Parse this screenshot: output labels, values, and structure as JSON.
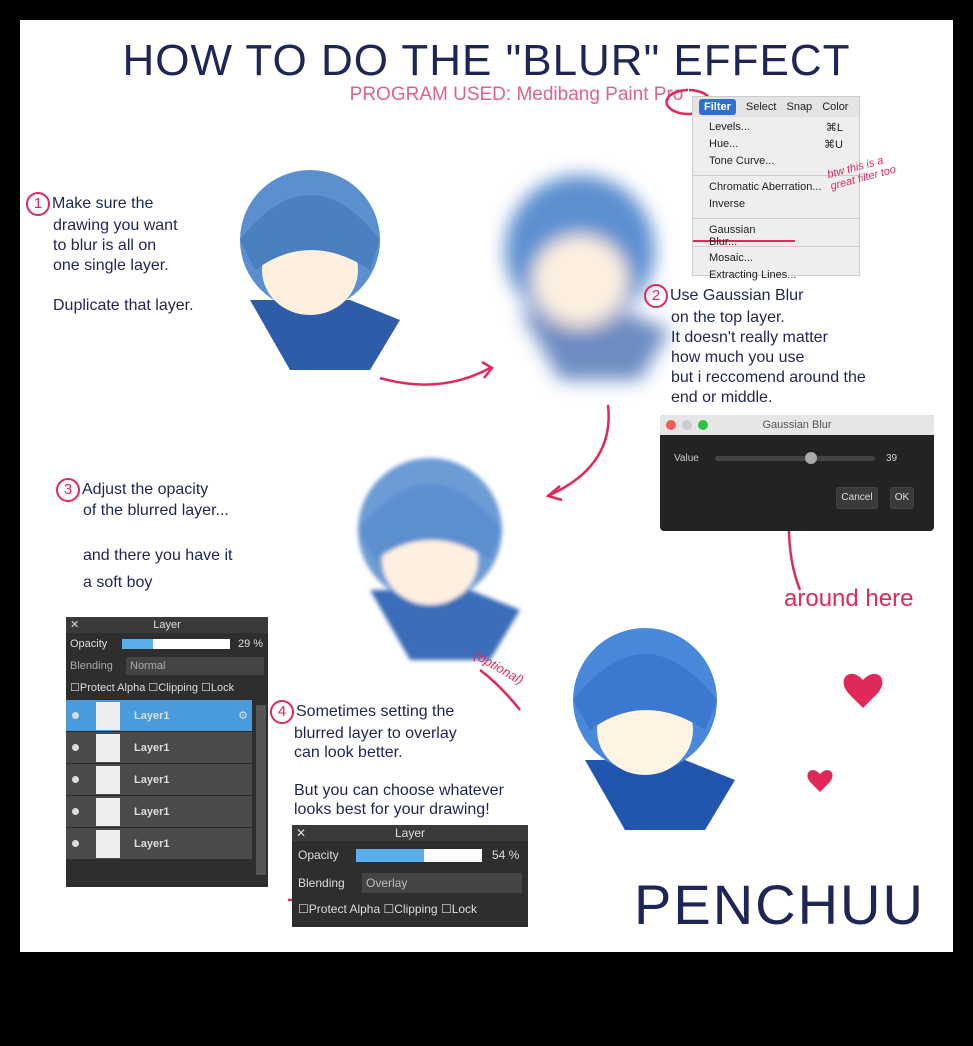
{
  "title": "HOW TO DO THE \"BLUR\" EFFECT",
  "subtitle": "PROGRAM USED: Medibang Paint Pro",
  "steps": [
    {
      "num": "1",
      "lines": [
        "Make sure the",
        "drawing you want",
        "to blur is all on",
        "one single layer."
      ],
      "extra": "Duplicate that layer."
    },
    {
      "num": "2",
      "lines": [
        "Use Gaussian Blur",
        "on the top layer.",
        "It doesn't really matter",
        "how much you use",
        "but i reccomend around the",
        "end or middle."
      ]
    },
    {
      "num": "3",
      "lines": [
        "Adjust the opacity",
        "of the blurred layer..."
      ],
      "extra": "and there you have it",
      "extra2": "a soft boy"
    },
    {
      "num": "4",
      "lines": [
        "Sometimes setting the",
        "blurred layer to overlay",
        "can look better."
      ],
      "extra": "But you can choose whatever",
      "extra2": "looks best for your drawing!"
    }
  ],
  "menu": {
    "bar": [
      "Filter",
      "Select",
      "Snap",
      "Color"
    ],
    "items": [
      [
        "Levels...",
        "⌘L"
      ],
      [
        "Hue...",
        "⌘U"
      ],
      [
        "Tone Curve...",
        ""
      ],
      [
        "Chromatic Aberration...",
        ""
      ],
      [
        "Inverse",
        ""
      ],
      [
        "Gaussian Blur...",
        ""
      ],
      [
        "Mosaic...",
        ""
      ],
      [
        "Extracting Lines...",
        ""
      ]
    ]
  },
  "note_btw": "btw this is a great filter too",
  "dialog": {
    "title": "Gaussian Blur",
    "label": "Value",
    "value": "39",
    "slider_fraction": 0.6,
    "cancel": "Cancel",
    "ok": "OK"
  },
  "around_here": "around here",
  "optional": "(optional)",
  "layer_panel1": {
    "title": "Layer",
    "opacity_label": "Opacity",
    "opacity": 29,
    "opacity_text": "29 %",
    "blending_label": "Blending",
    "blending": "Normal",
    "protect": "Protect Alpha",
    "clipping": "Clipping",
    "lock": "Lock",
    "layers": [
      "Layer1",
      "Layer1",
      "Layer1",
      "Layer1",
      "Layer1"
    ]
  },
  "layer_panel2": {
    "title": "Layer",
    "opacity_label": "Opacity",
    "opacity": 54,
    "opacity_text": "54 %",
    "blending_label": "Blending",
    "blending": "Overlay",
    "protect": "Protect Alpha",
    "clipping": "Clipping",
    "lock": "Lock"
  },
  "signature": "PENCHUU",
  "colors": {
    "navy": "#1d2657",
    "pink": "#e0285a",
    "hair": "#4a7fc0"
  }
}
